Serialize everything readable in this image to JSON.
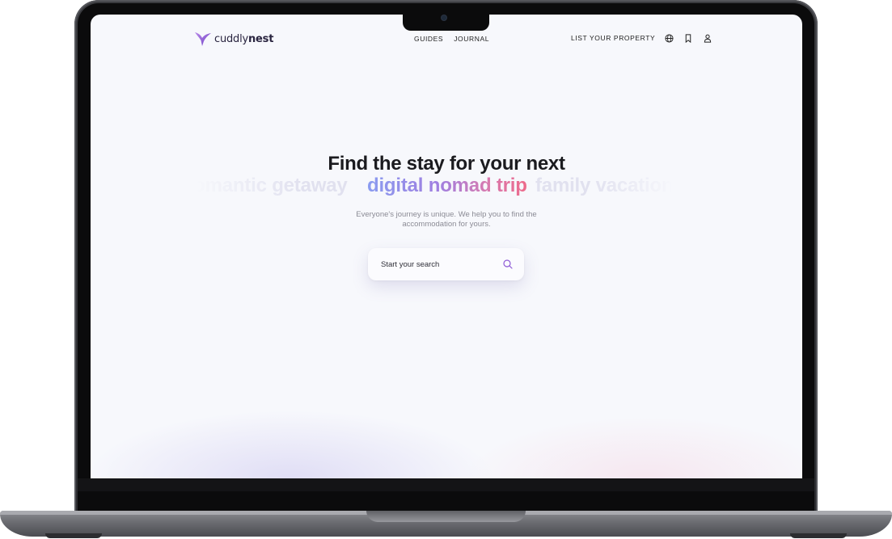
{
  "brand": {
    "name_light": "cuddly",
    "name_bold": "nest",
    "accent": "#8e5ad6"
  },
  "nav": {
    "center_links": [
      "GUIDES",
      "JOURNAL"
    ],
    "list_property": "LIST YOUR PROPERTY",
    "icons": [
      "globe-icon",
      "bookmark-icon",
      "user-icon"
    ]
  },
  "hero": {
    "title": "Find the stay for your next",
    "rotating": {
      "previous": "romantic getaway",
      "current": "digital nomad trip",
      "next": "family vacation"
    },
    "subtitle_line1": "Everyone's journey is unique. We help you to find the",
    "subtitle_line2": "accommodation for yours."
  },
  "search": {
    "placeholder": "Start your search",
    "icon": "search-icon"
  },
  "colors": {
    "page_bg": "#f7f8fc",
    "gradient_start": "#8a9cf0",
    "gradient_end": "#ee6a8a"
  }
}
